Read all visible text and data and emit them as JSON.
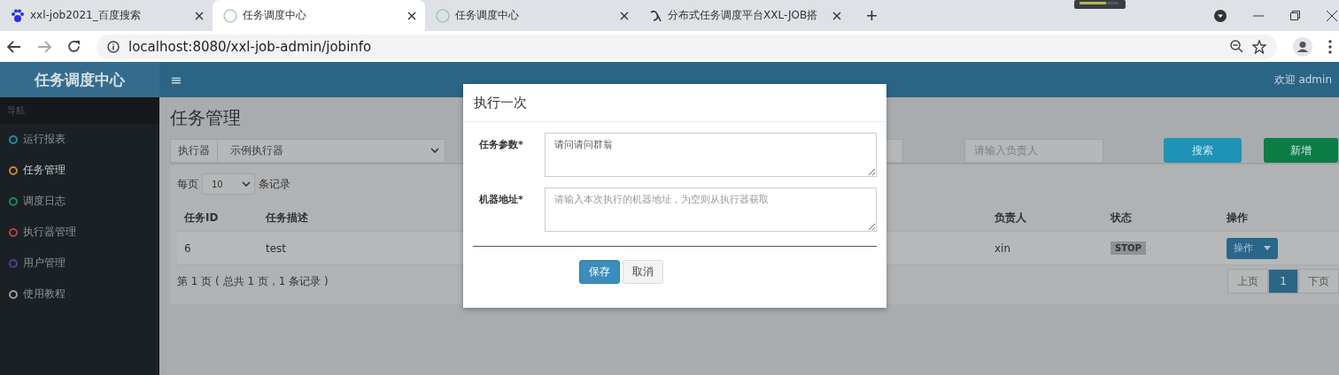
{
  "browser": {
    "tabs": [
      {
        "title": "xxl-job2021_百度搜索",
        "selected": false
      },
      {
        "title": "任务调度中心",
        "selected": true
      },
      {
        "title": "任务调度中心",
        "selected": false
      },
      {
        "title": "分布式任务调度平台XXL-JOB搭",
        "selected": false
      }
    ],
    "new_tab": "+",
    "url": "localhost:8080/xxl-job-admin/jobinfo"
  },
  "header": {
    "logo": "任务调度中心",
    "menu_glyph": "≡",
    "user": "欢迎 admin"
  },
  "sidebar": {
    "heading": "导航",
    "items": [
      {
        "label": "运行报表",
        "color": "#1b8ea6",
        "selected": false
      },
      {
        "label": "任务管理",
        "color": "#c98a2c",
        "selected": true
      },
      {
        "label": "调度日志",
        "color": "#168a5c",
        "selected": false
      },
      {
        "label": "执行器管理",
        "color": "#b04148",
        "selected": false
      },
      {
        "label": "用户管理",
        "color": "#4d3f95",
        "selected": false
      },
      {
        "label": "使用教程",
        "color": "#9a9c9e",
        "selected": false
      }
    ]
  },
  "page": {
    "title": "任务管理",
    "filter": {
      "executor_label": "执行器",
      "executor_value": "示例执行器",
      "owner_placeholder": "请输入负责人",
      "search": "搜索",
      "add": "新增"
    },
    "page_size": {
      "before": "每页",
      "value": "10",
      "after": "条记录"
    },
    "table": {
      "columns": [
        "任务ID",
        "任务描述",
        "负责人",
        "状态",
        "操作"
      ],
      "rows": [
        {
          "cells": [
            "6",
            "test",
            "xin"
          ],
          "status": "STOP",
          "action": "操作"
        }
      ]
    },
    "pager_info": "第 1 页 ( 总共 1 页，1 条记录 )",
    "pager": [
      {
        "label": "上页",
        "selected": false
      },
      {
        "label": "1",
        "selected": true
      },
      {
        "label": "下页",
        "selected": false
      }
    ]
  },
  "modal": {
    "title": "执行一次",
    "fields": [
      {
        "label": "任务参数*",
        "value": "请问请问群翁"
      },
      {
        "label": "机器地址*",
        "placeholder": "请输入本次执行的机器地址，为空则从执行器获取"
      }
    ],
    "buttons": [
      {
        "label": "保存",
        "kind": "primary"
      },
      {
        "label": "取消",
        "kind": "default"
      }
    ]
  }
}
